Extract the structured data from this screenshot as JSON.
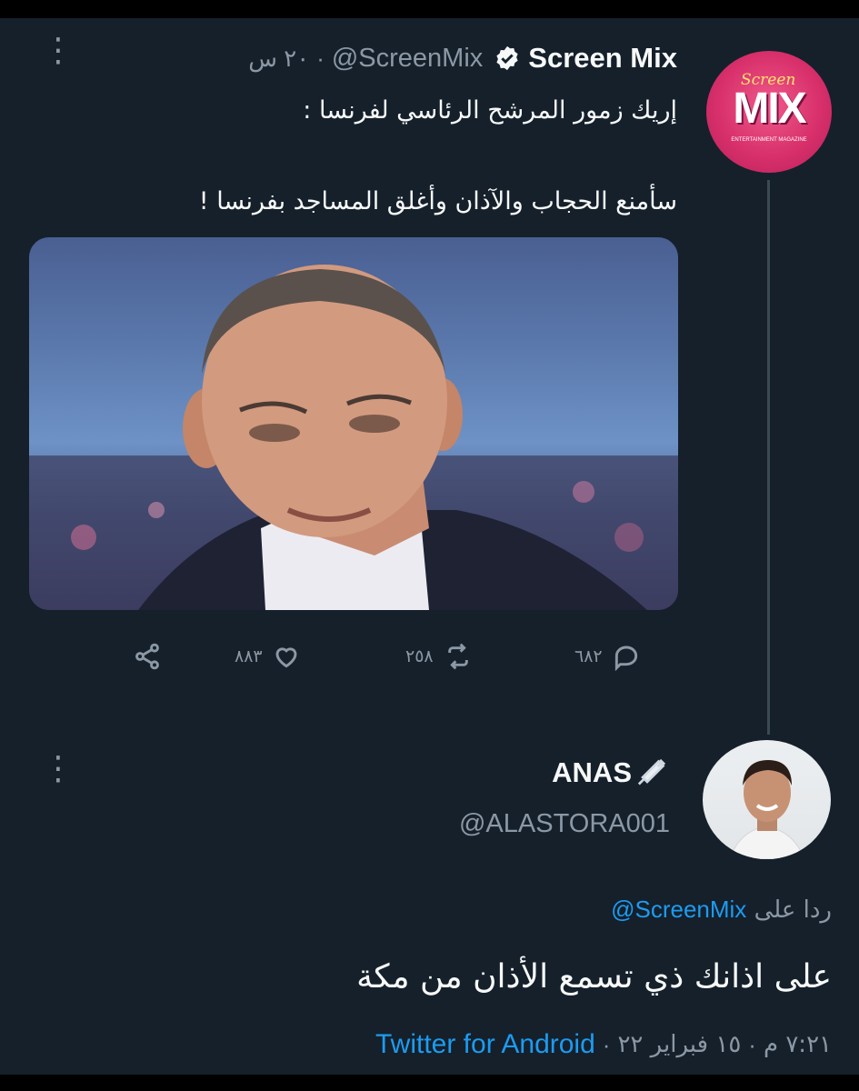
{
  "tweet": {
    "display_name": "Screen Mix",
    "handle": "@ScreenMix",
    "separator": "·",
    "time": "٢٠ س",
    "text_line1": "إريك زمور المرشح الرئاسي لفرنسا :",
    "text_line2": "سأمنع الحجاب والآذان وأغلق المساجد بفرنسا !",
    "avatar": {
      "logo_text": "MIX",
      "script_text": "Screen",
      "tagline": "ENTERTAINMENT MAGAZINE"
    },
    "media_description_icon": "photo",
    "actions": {
      "reply_count": "٦٨٢",
      "retweet_count": "٢٥٨",
      "like_count": "٨٨٣"
    }
  },
  "reply": {
    "display_name": "ANAS",
    "name_emoji_icon": "syringe-icon",
    "handle": "@ALASTORA001",
    "replying_to_prefix": "ردا على",
    "replying_to_handle": "@ScreenMix",
    "text": "على اذانك ذي تسمع الأذان من مكة",
    "meta_time": "٧:٢١ م",
    "meta_separator": "·",
    "meta_date": "١٥ فبراير ٢٢",
    "meta_source": "Twitter for Android"
  },
  "colors": {
    "background": "#15202b",
    "text": "#f7f9f9",
    "muted": "#8b98a5",
    "link": "#1d9bf0",
    "avatar_pink": "#d8306b"
  }
}
